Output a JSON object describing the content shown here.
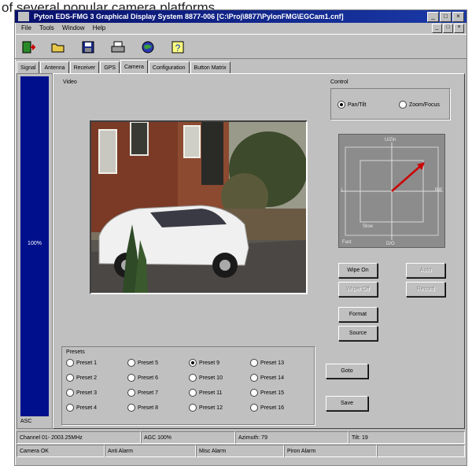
{
  "caption": "of several popular camera platforms.",
  "window": {
    "title": "Pyton EDS-FMG 3 Graphical Display System 8877-006 [C:\\Proj\\8877\\PylonFMG\\EGCam1.cnf]",
    "controls": [
      "_",
      "□",
      "×"
    ]
  },
  "menu": [
    "File",
    "Tools",
    "Window",
    "Help"
  ],
  "mdi_controls": [
    "_",
    "□",
    "×"
  ],
  "toolbar": [
    "exit-icon",
    "open-folder-icon",
    "save-disk-icon",
    "print-icon",
    "globe-icon",
    "help-icon"
  ],
  "tabs": [
    "Signal",
    "Antenna",
    "Receiver",
    "GPS",
    "Camera",
    "Configuration",
    "Button Matrix"
  ],
  "active_tab": "Camera",
  "signal": {
    "value_label": "100%",
    "level": 1.0,
    "bottom_label": "ASC"
  },
  "video_label": "Video",
  "control": {
    "label": "Control",
    "modes": [
      "Pan/Tilt",
      "Zoom/Focus"
    ],
    "selected_mode": "Pan/Tilt",
    "ptz_labels": {
      "top": "U/Zin",
      "bottom": "D/O",
      "left": "L",
      "right": "R/F",
      "slow": "Slow",
      "fast": "Fast"
    },
    "buttons": [
      {
        "label": "Wipe On",
        "enabled": true
      },
      {
        "label": "Auto",
        "enabled": false
      },
      {
        "label": "Wiper Off",
        "enabled": false
      },
      {
        "label": "Record",
        "enabled": false
      },
      {
        "label": "Format",
        "enabled": true
      },
      {
        "label": "Source",
        "enabled": true
      }
    ]
  },
  "presets": {
    "label": "Presets",
    "items": [
      "Preset 1",
      "Preset 2",
      "Preset 3",
      "Preset 4",
      "Preset 5",
      "Preset 6",
      "Preset 7",
      "Preset 8",
      "Preset 9",
      "Preset 10",
      "Preset 11",
      "Preset 12",
      "Preset 13",
      "Preset 14",
      "Preset 15",
      "Preset 16"
    ],
    "selected": "Preset 9",
    "goto_label": "Goto",
    "save_label": "Save"
  },
  "status": {
    "row1": [
      "Channel 01- 2003.25MHz",
      "AGC 100%",
      "Azimuth: 79",
      "Tilt: 19"
    ],
    "row2": [
      "Camera OK",
      "Anti Alarm",
      "Misc Alarm",
      "Piron Alarm",
      ""
    ]
  },
  "colors": {
    "title_bar": "#08106b",
    "signal_bar": "#00108c",
    "ptz_arrow": "#cc0000",
    "window_face": "#c0c0c0"
  }
}
